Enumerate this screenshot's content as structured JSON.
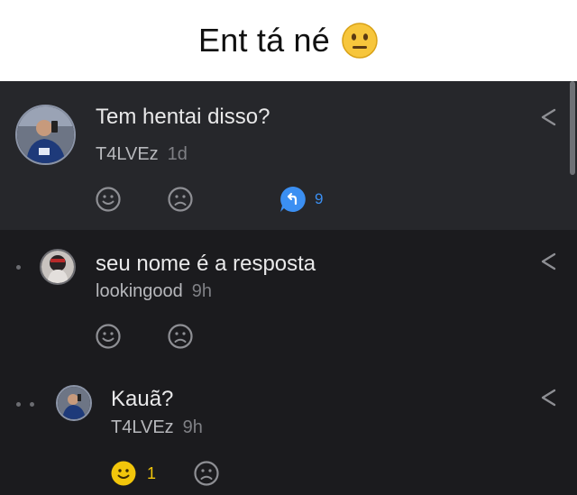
{
  "caption": {
    "text": "Ent tá né",
    "emoji": "neutral-face-emoji"
  },
  "comments": [
    {
      "text": "Tem hentai disso?",
      "author": "T4LVEz",
      "time": "1d",
      "reply_count": "9",
      "avatar": "avatar-photo"
    },
    {
      "text": "seu nome é a resposta",
      "author": "lookingood",
      "time": "9h",
      "avatar": "avatar-photo"
    },
    {
      "text": "Kauã?",
      "author": "T4LVEz",
      "time": "9h",
      "like_count": "1",
      "avatar": "avatar-photo"
    }
  ],
  "colors": {
    "accent_blue": "#3b8ff2",
    "like_yellow": "#f2c60b",
    "background": "#1b1b1e",
    "highlighted_comment": "#26272b"
  }
}
